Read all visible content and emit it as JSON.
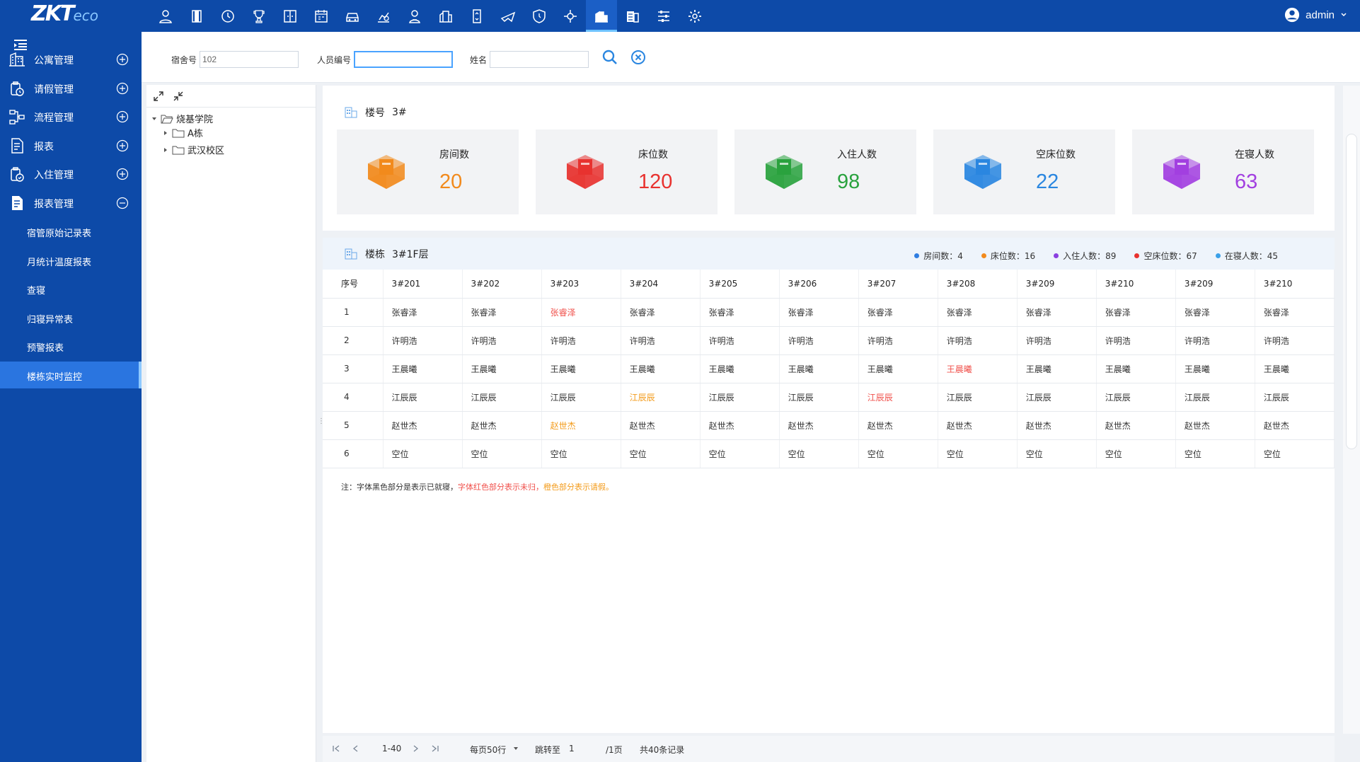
{
  "app": {
    "logo_main": "ZKT",
    "logo_eco": "eco",
    "user_name": "admin"
  },
  "top_icons": [
    "person-icon",
    "card-icon",
    "clock-icon",
    "trophy-icon",
    "door-icon",
    "schedule-icon",
    "car-icon",
    "chart-person-icon",
    "visitor-icon",
    "building-icon",
    "elevator-icon",
    "plane-icon",
    "shield-icon",
    "network-icon",
    "dormitory-icon",
    "office-icon",
    "sliders-icon",
    "gear-icon"
  ],
  "sidebar": {
    "menus": [
      {
        "label": "公寓管理"
      },
      {
        "label": "请假管理"
      },
      {
        "label": "流程管理"
      },
      {
        "label": "报表"
      },
      {
        "label": "入住管理"
      },
      {
        "label": "报表管理"
      }
    ],
    "submenus": [
      {
        "label": "宿管原始记录表"
      },
      {
        "label": "月统计温度报表"
      },
      {
        "label": "查寝"
      },
      {
        "label": "归寝异常表"
      },
      {
        "label": "预警报表"
      },
      {
        "label": "楼栋实时监控"
      }
    ]
  },
  "search": {
    "dorm_label": "宿舍号",
    "dorm_value": "102",
    "person_label": "人员编号",
    "person_value": "",
    "name_label": "姓名",
    "name_value": ""
  },
  "tree": {
    "root": "烧基学院",
    "children": [
      "A栋",
      "武汉校区"
    ]
  },
  "building": {
    "title_label": "楼号",
    "title_value": "3#",
    "stats": [
      {
        "label": "房间数",
        "value": "20",
        "color": "#f28a1c"
      },
      {
        "label": "床位数",
        "value": "120",
        "color": "#e8322f"
      },
      {
        "label": "入住人数",
        "value": "98",
        "color": "#2aa23e"
      },
      {
        "label": "空床位数",
        "value": "22",
        "color": "#2a86e0"
      },
      {
        "label": "在寝人数",
        "value": "63",
        "color": "#a23fe0"
      }
    ]
  },
  "floor": {
    "title_label": "楼栋",
    "title_value": "3#1F层",
    "legend": [
      {
        "text": "房间数：4",
        "color": "#2f7de1"
      },
      {
        "text": "床位数：16",
        "color": "#f28a1c"
      },
      {
        "text": "入住人数：89",
        "color": "#8a3fe0"
      },
      {
        "text": "空床位数：67",
        "color": "#e8322f"
      },
      {
        "text": "在寝人数：45",
        "color": "#3aa0e8"
      }
    ],
    "columns": [
      "序号",
      "3#201",
      "3#202",
      "3#203",
      "3#204",
      "3#205",
      "3#206",
      "3#207",
      "3#208",
      "3#209",
      "3#210",
      "3#209",
      "3#210"
    ],
    "rows": [
      {
        "seq": "1",
        "cells": [
          [
            "张睿泽",
            ""
          ],
          [
            "张睿泽",
            ""
          ],
          [
            "张睿泽",
            "red"
          ],
          [
            "张睿泽",
            ""
          ],
          [
            "张睿泽",
            ""
          ],
          [
            "张睿泽",
            ""
          ],
          [
            "张睿泽",
            ""
          ],
          [
            "张睿泽",
            ""
          ],
          [
            "张睿泽",
            ""
          ],
          [
            "张睿泽",
            ""
          ],
          [
            "张睿泽",
            ""
          ],
          [
            "张睿泽",
            ""
          ]
        ]
      },
      {
        "seq": "2",
        "cells": [
          [
            "许明浩",
            ""
          ],
          [
            "许明浩",
            ""
          ],
          [
            "许明浩",
            ""
          ],
          [
            "许明浩",
            ""
          ],
          [
            "许明浩",
            ""
          ],
          [
            "许明浩",
            ""
          ],
          [
            "许明浩",
            ""
          ],
          [
            "许明浩",
            ""
          ],
          [
            "许明浩",
            ""
          ],
          [
            "许明浩",
            ""
          ],
          [
            "许明浩",
            ""
          ],
          [
            "许明浩",
            ""
          ]
        ]
      },
      {
        "seq": "3",
        "cells": [
          [
            "王晨曦",
            ""
          ],
          [
            "王晨曦",
            ""
          ],
          [
            "王晨曦",
            ""
          ],
          [
            "王晨曦",
            ""
          ],
          [
            "王晨曦",
            ""
          ],
          [
            "王晨曦",
            ""
          ],
          [
            "王晨曦",
            ""
          ],
          [
            "王晨曦",
            "red"
          ],
          [
            "王晨曦",
            ""
          ],
          [
            "王晨曦",
            ""
          ],
          [
            "王晨曦",
            ""
          ],
          [
            "王晨曦",
            ""
          ]
        ]
      },
      {
        "seq": "4",
        "cells": [
          [
            "江辰辰",
            ""
          ],
          [
            "江辰辰",
            ""
          ],
          [
            "江辰辰",
            ""
          ],
          [
            "江辰辰",
            "orange"
          ],
          [
            "江辰辰",
            ""
          ],
          [
            "江辰辰",
            ""
          ],
          [
            "江辰辰",
            "red"
          ],
          [
            "江辰辰",
            ""
          ],
          [
            "江辰辰",
            ""
          ],
          [
            "江辰辰",
            ""
          ],
          [
            "江辰辰",
            ""
          ],
          [
            "江辰辰",
            ""
          ]
        ]
      },
      {
        "seq": "5",
        "cells": [
          [
            "赵世杰",
            ""
          ],
          [
            "赵世杰",
            ""
          ],
          [
            "赵世杰",
            "orange"
          ],
          [
            "赵世杰",
            ""
          ],
          [
            "赵世杰",
            ""
          ],
          [
            "赵世杰",
            ""
          ],
          [
            "赵世杰",
            ""
          ],
          [
            "赵世杰",
            ""
          ],
          [
            "赵世杰",
            ""
          ],
          [
            "赵世杰",
            ""
          ],
          [
            "赵世杰",
            ""
          ],
          [
            "赵世杰",
            ""
          ]
        ]
      },
      {
        "seq": "6",
        "cells": [
          [
            "空位",
            ""
          ],
          [
            "空位",
            ""
          ],
          [
            "空位",
            ""
          ],
          [
            "空位",
            ""
          ],
          [
            "空位",
            ""
          ],
          [
            "空位",
            ""
          ],
          [
            "空位",
            ""
          ],
          [
            "空位",
            ""
          ],
          [
            "空位",
            ""
          ],
          [
            "空位",
            ""
          ],
          [
            "空位",
            ""
          ],
          [
            "空位",
            ""
          ]
        ]
      }
    ],
    "note_black": "注：字体黑色部分是表示已就寝，",
    "note_red": "字体红色部分表示未归，",
    "note_orange": "橙色部分表示请假。"
  },
  "pager": {
    "range": "1-40",
    "per_page": "每页50行",
    "goto_label": "跳转至",
    "goto_value": "1",
    "total_pages": "/1页",
    "total_records": "共40条记录"
  }
}
